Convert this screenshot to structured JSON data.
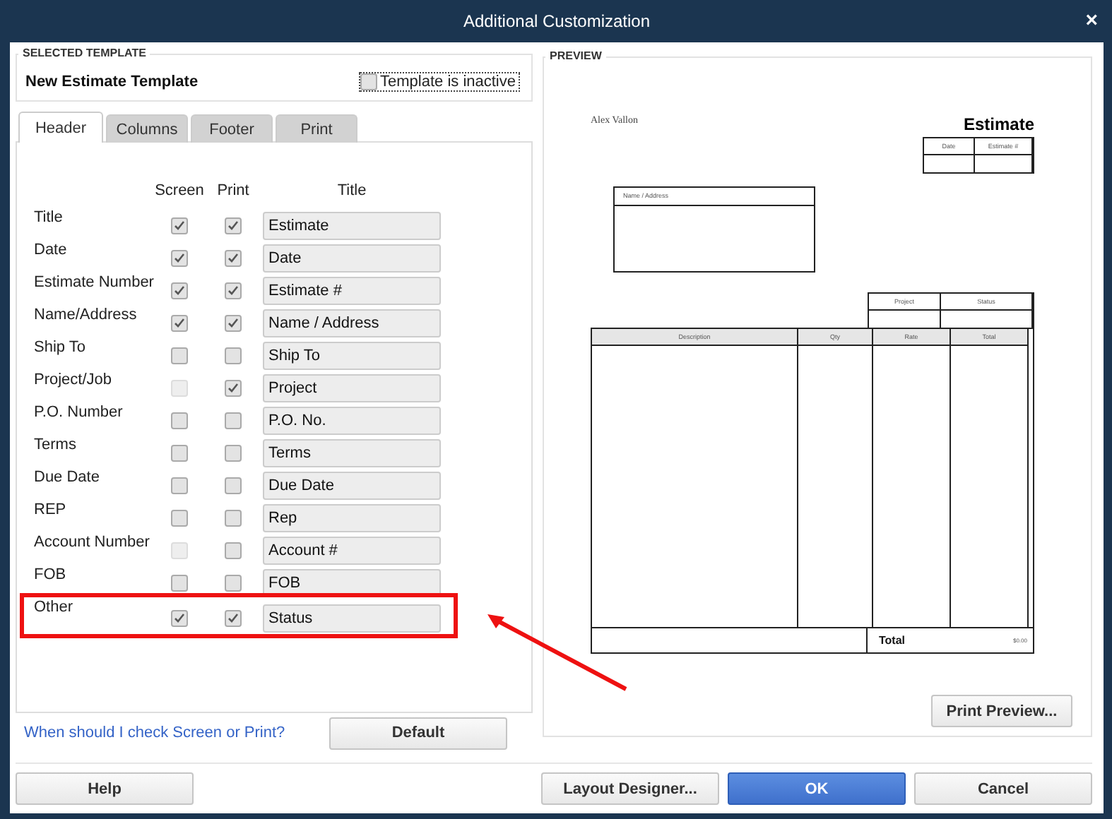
{
  "window": {
    "title": "Additional Customization",
    "close": "×"
  },
  "selected_template": {
    "legend": "SELECTED TEMPLATE",
    "name": "New Estimate Template",
    "inactive_label": "Template is inactive",
    "inactive_checked": false
  },
  "tabs": [
    {
      "label": "Header",
      "selected": true
    },
    {
      "label": "Columns",
      "selected": false
    },
    {
      "label": "Footer",
      "selected": false
    },
    {
      "label": "Print",
      "selected": false
    }
  ],
  "columns": [
    "Screen",
    "Print",
    "Title"
  ],
  "rows": [
    {
      "label": "Title",
      "screen_checked": true,
      "screen_disabled": false,
      "print_checked": true,
      "title": "Estimate",
      "highlighted": false
    },
    {
      "label": "Date",
      "screen_checked": true,
      "screen_disabled": false,
      "print_checked": true,
      "title": "Date",
      "highlighted": false
    },
    {
      "label": "Estimate Number",
      "screen_checked": true,
      "screen_disabled": false,
      "print_checked": true,
      "title": "Estimate #",
      "highlighted": false
    },
    {
      "label": "Name/Address",
      "screen_checked": true,
      "screen_disabled": false,
      "print_checked": true,
      "title": "Name / Address",
      "highlighted": false
    },
    {
      "label": "Ship To",
      "screen_checked": false,
      "screen_disabled": false,
      "print_checked": false,
      "title": "Ship To",
      "highlighted": false
    },
    {
      "label": "Project/Job",
      "screen_checked": false,
      "screen_disabled": true,
      "print_checked": true,
      "title": "Project",
      "highlighted": false
    },
    {
      "label": "P.O. Number",
      "screen_checked": false,
      "screen_disabled": false,
      "print_checked": false,
      "title": "P.O. No.",
      "highlighted": false
    },
    {
      "label": "Terms",
      "screen_checked": false,
      "screen_disabled": false,
      "print_checked": false,
      "title": "Terms",
      "highlighted": false
    },
    {
      "label": "Due Date",
      "screen_checked": false,
      "screen_disabled": false,
      "print_checked": false,
      "title": "Due Date",
      "highlighted": false
    },
    {
      "label": "REP",
      "screen_checked": false,
      "screen_disabled": false,
      "print_checked": false,
      "title": "Rep",
      "highlighted": false
    },
    {
      "label": "Account Number",
      "screen_checked": false,
      "screen_disabled": true,
      "print_checked": false,
      "title": "Account #",
      "highlighted": false
    },
    {
      "label": "FOB",
      "screen_checked": false,
      "screen_disabled": false,
      "print_checked": false,
      "title": "FOB",
      "highlighted": false
    },
    {
      "label": "Other",
      "screen_checked": true,
      "screen_disabled": false,
      "print_checked": true,
      "title": "Status",
      "highlighted": true
    }
  ],
  "help_link": "When should I check Screen or Print?",
  "default_button": "Default",
  "preview": {
    "legend": "PREVIEW",
    "company": "Alex Vallon",
    "doc_title": "Estimate",
    "date_table": [
      "Date",
      "Estimate #"
    ],
    "address_label": "Name / Address",
    "project_table": [
      "Project",
      "Status"
    ],
    "item_columns": [
      "Description",
      "Qty",
      "Rate",
      "Total"
    ],
    "total_label": "Total",
    "total_value": "$0.00",
    "print_preview_button": "Print Preview..."
  },
  "footer_left_buttons": [
    {
      "label": "Help",
      "kind": "normal"
    }
  ],
  "footer_right_buttons": [
    {
      "label": "Layout Designer...",
      "kind": "normal"
    },
    {
      "label": "OK",
      "kind": "primary"
    },
    {
      "label": "Cancel",
      "kind": "normal"
    }
  ]
}
